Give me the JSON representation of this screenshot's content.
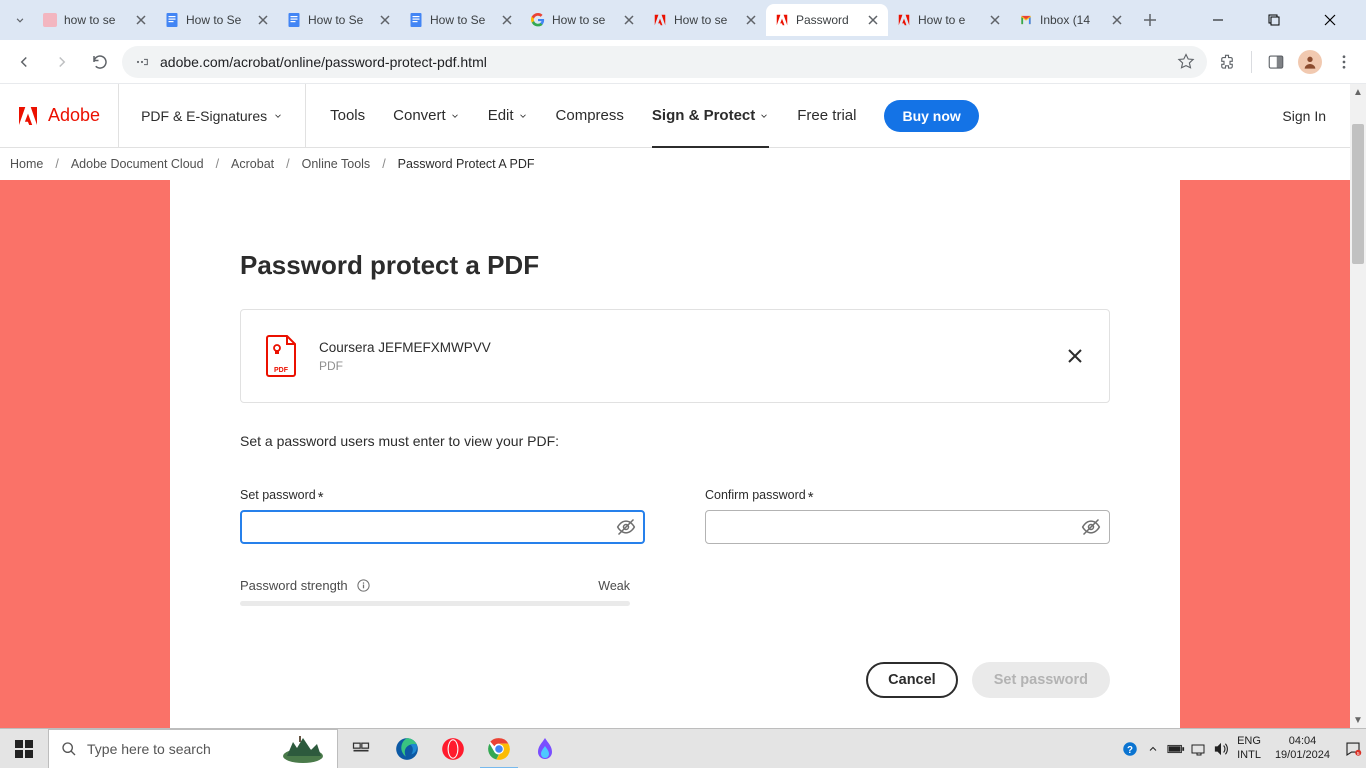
{
  "browser": {
    "tabs": [
      {
        "title": "how to se"
      },
      {
        "title": "How to Se"
      },
      {
        "title": "How to Se"
      },
      {
        "title": "How to Se"
      },
      {
        "title": "How to se"
      },
      {
        "title": "How to se"
      },
      {
        "title": "Password"
      },
      {
        "title": "How to e"
      },
      {
        "title": "Inbox (14"
      }
    ],
    "active_tab_index": 6,
    "url": "adobe.com/acrobat/online/password-protect-pdf.html"
  },
  "adobe": {
    "brand": "Adobe",
    "pdf_esign": "PDF & E-Signatures",
    "nav": {
      "tools": "Tools",
      "convert": "Convert",
      "edit": "Edit",
      "compress": "Compress",
      "sign_protect": "Sign & Protect",
      "free_trial": "Free trial",
      "buy_now": "Buy now"
    },
    "sign_in": "Sign In",
    "breadcrumb": {
      "home": "Home",
      "doccloud": "Adobe Document Cloud",
      "acrobat": "Acrobat",
      "online_tools": "Online Tools",
      "current": "Password Protect A PDF"
    }
  },
  "page": {
    "title": "Password protect a PDF",
    "file": {
      "name": "Coursera JEFMEFXMWPVV",
      "type": "PDF"
    },
    "instruction": "Set a password users must enter to view your PDF:",
    "set_password_label": "Set password",
    "confirm_password_label": "Confirm password",
    "strength_label": "Password strength",
    "strength_value": "Weak",
    "cancel": "Cancel",
    "set_password_btn": "Set password"
  },
  "taskbar": {
    "search_placeholder": "Type here to search",
    "lang1": "ENG",
    "lang2": "INTL",
    "time": "04:04",
    "date": "19/01/2024"
  }
}
